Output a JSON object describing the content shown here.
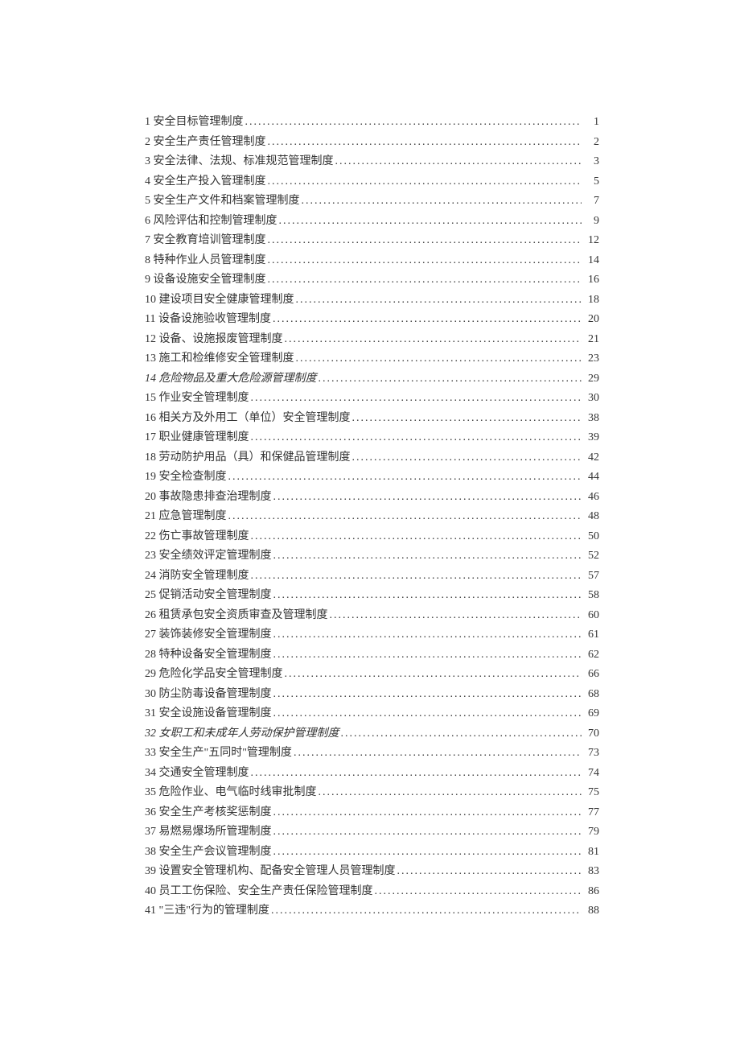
{
  "toc": [
    {
      "num": "1",
      "title": "安全目标管理制度",
      "page": "1",
      "italic": false
    },
    {
      "num": "2",
      "title": "安全生产责任管理制度",
      "page": "2",
      "italic": false
    },
    {
      "num": "3",
      "title": "安全法律、法规、标准规范管理制度",
      "page": "3",
      "italic": false
    },
    {
      "num": "4",
      "title": "安全生产投入管理制度",
      "page": "5",
      "italic": false
    },
    {
      "num": "5",
      "title": "安全生产文件和档案管理制度",
      "page": "7",
      "italic": false
    },
    {
      "num": "6",
      "title": "风险评估和控制管理制度",
      "page": "9",
      "italic": false
    },
    {
      "num": "7",
      "title": "安全教育培训管理制度",
      "page": "12",
      "italic": false
    },
    {
      "num": "8",
      "title": "特种作业人员管理制度",
      "page": "14",
      "italic": false
    },
    {
      "num": "9",
      "title": "设备设施安全管理制度",
      "page": "16",
      "italic": false
    },
    {
      "num": "10",
      "title": "建设项目安全健康管理制度",
      "page": "18",
      "italic": false
    },
    {
      "num": "11",
      "title": "设备设施验收管理制度",
      "page": "20",
      "italic": false
    },
    {
      "num": "12",
      "title": "设备、设施报废管理制度",
      "page": "21",
      "italic": false
    },
    {
      "num": "13",
      "title": "施工和检维修安全管理制度",
      "page": "23",
      "italic": false
    },
    {
      "num": "14",
      "title": "危险物品及重大危险源管理制度",
      "page": "29",
      "italic": true
    },
    {
      "num": "15",
      "title": "作业安全管理制度",
      "page": "30",
      "italic": false
    },
    {
      "num": "16",
      "title": "相关方及外用工（单位）安全管理制度",
      "page": "38",
      "italic": false
    },
    {
      "num": "17",
      "title": "职业健康管理制度",
      "page": "39",
      "italic": false
    },
    {
      "num": "18",
      "title": "劳动防护用品（具）和保健品管理制度",
      "page": "42",
      "italic": false
    },
    {
      "num": "19",
      "title": "安全检查制度",
      "page": "44",
      "italic": false
    },
    {
      "num": "20",
      "title": "事故隐患排查治理制度",
      "page": "46",
      "italic": false
    },
    {
      "num": "21",
      "title": "应急管理制度",
      "page": "48",
      "italic": false
    },
    {
      "num": "22",
      "title": "伤亡事故管理制度",
      "page": "50",
      "italic": false
    },
    {
      "num": "23",
      "title": "安全绩效评定管理制度",
      "page": "52",
      "italic": false
    },
    {
      "num": "24",
      "title": "消防安全管理制度",
      "page": "57",
      "italic": false
    },
    {
      "num": "25",
      "title": "促销活动安全管理制度",
      "page": "58",
      "italic": false
    },
    {
      "num": "26",
      "title": "租赁承包安全资质审查及管理制度",
      "page": "60",
      "italic": false
    },
    {
      "num": "27",
      "title": "装饰装修安全管理制度",
      "page": "61",
      "italic": false
    },
    {
      "num": "28",
      "title": "特种设备安全管理制度",
      "page": "62",
      "italic": false
    },
    {
      "num": "29",
      "title": "危险化学品安全管理制度",
      "page": "66",
      "italic": false
    },
    {
      "num": "30",
      "title": "防尘防毒设备管理制度",
      "page": "68",
      "italic": false
    },
    {
      "num": "31",
      "title": "安全设施设备管理制度",
      "page": "69",
      "italic": false
    },
    {
      "num": "32",
      "title": "女职工和未成年人劳动保护管理制度",
      "page": "70",
      "italic": true
    },
    {
      "num": "33",
      "title": "安全生产\"五同时\"管理制度",
      "page": "73",
      "italic": false
    },
    {
      "num": "34",
      "title": "交通安全管理制度",
      "page": "74",
      "italic": false
    },
    {
      "num": "35",
      "title": "危险作业、电气临时线审批制度",
      "page": "75",
      "italic": false
    },
    {
      "num": "36",
      "title": "安全生产考核奖惩制度",
      "page": "77",
      "italic": false
    },
    {
      "num": "37",
      "title": "易燃易爆场所管理制度",
      "page": "79",
      "italic": false
    },
    {
      "num": "38",
      "title": "安全生产会议管理制度",
      "page": "81",
      "italic": false
    },
    {
      "num": "39",
      "title": "设置安全管理机构、配备安全管理人员管理制度",
      "page": "83",
      "italic": false
    },
    {
      "num": "40",
      "title": "员工工伤保险、安全生产责任保险管理制度",
      "page": "86",
      "italic": false
    },
    {
      "num": "41",
      "title": "\"三违\"行为的管理制度",
      "page": "88",
      "italic": false
    }
  ]
}
